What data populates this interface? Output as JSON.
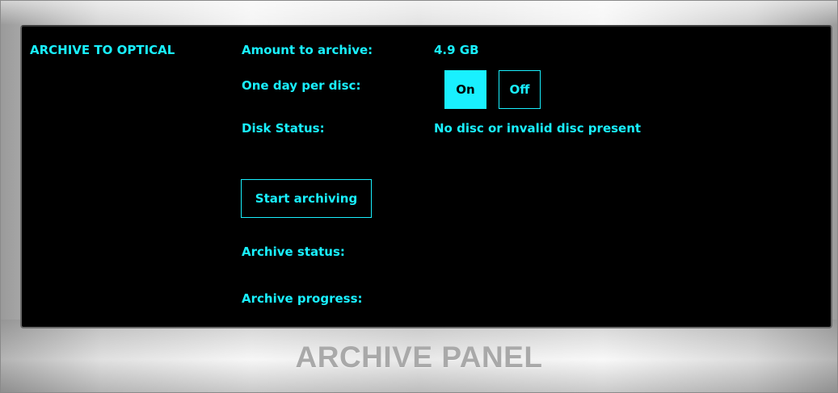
{
  "section_title": "ARCHIVE TO OPTICAL",
  "amount": {
    "label": "Amount to archive:",
    "value": "4.9 GB"
  },
  "one_day_per_disc": {
    "label": "One day per disc:",
    "on_label": "On",
    "off_label": "Off",
    "selected": "On"
  },
  "disk_status": {
    "label": "Disk Status:",
    "value": "No disc or invalid disc present"
  },
  "start_button": {
    "label": "Start archiving"
  },
  "archive_status": {
    "label": "Archive status:"
  },
  "archive_progress": {
    "label": "Archive progress:"
  },
  "panel_title": "ARCHIVE PANEL",
  "colors": {
    "accent": "#19f0ff",
    "screen_background": "#000000",
    "panel_title": "#a9a9a9"
  }
}
